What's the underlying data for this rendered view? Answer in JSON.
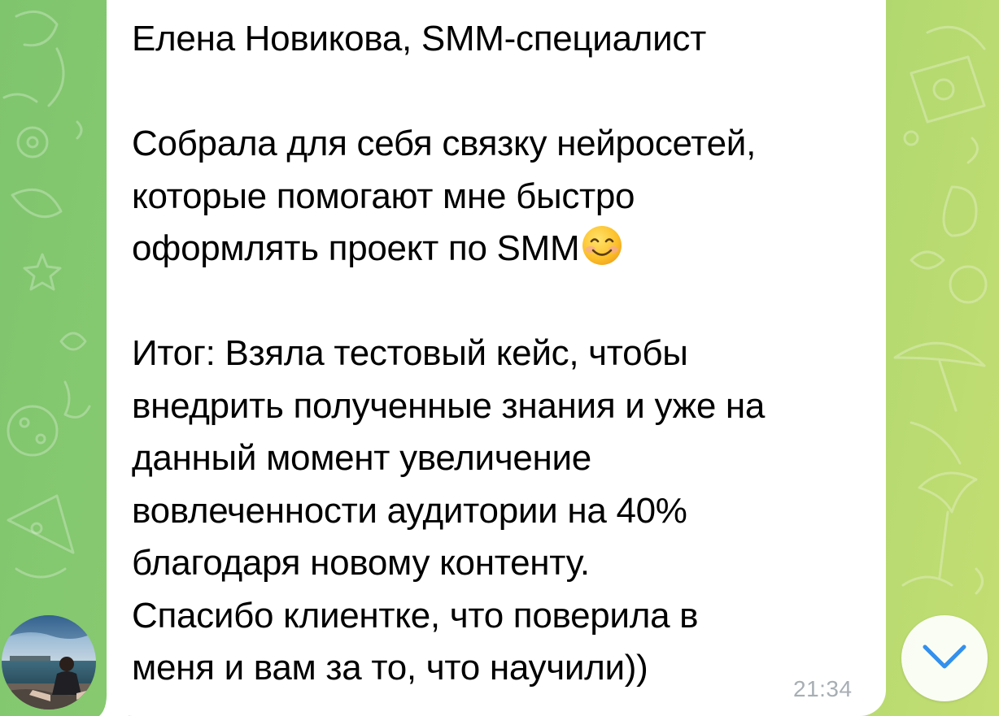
{
  "message": {
    "author_line": "Елена Новикова, SMM-специалист",
    "paragraph_1_text": "Собрала для себя связку нейросетей,\nкоторые помогают мне быстро\nоформлять проект по SMM",
    "paragraph_1_emoji": "smiling-face-emoji",
    "paragraph_2_text": "Итог: Взяла тестовый кейс, чтобы\nвнедрить полученные знания и уже на\nданный момент увеличение\nвовлеченности аудитории на 40%\nблагодаря новому контенту.\nСпасибо клиентке, что поверила в\nменя и вам за то, что научили))",
    "time": "21:34"
  },
  "avatar": {
    "icon": "user-photo-avatar"
  },
  "scroll_button": {
    "icon": "chevron-down-icon"
  },
  "colors": {
    "bubble": "#ffffff",
    "timestamp": "#a7aeb4",
    "accent": "#3390ec",
    "wallpaper_start": "#7fc56e",
    "wallpaper_end": "#c4de72"
  }
}
